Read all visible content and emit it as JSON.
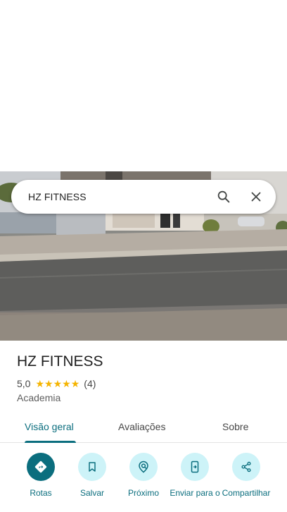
{
  "search": {
    "query": "HZ FITNESS"
  },
  "place": {
    "name": "HZ FITNESS",
    "rating": "5,0",
    "stars": 5,
    "review_count": "(4)",
    "category": "Academia"
  },
  "tabs": [
    {
      "label": "Visão geral",
      "active": true
    },
    {
      "label": "Avaliações",
      "active": false
    },
    {
      "label": "Sobre",
      "active": false
    }
  ],
  "actions": [
    {
      "label": "Rotas",
      "icon": "directions-icon"
    },
    {
      "label": "Salvar",
      "icon": "bookmark-icon"
    },
    {
      "label": "Próximo",
      "icon": "nearby-icon"
    },
    {
      "label": "Enviar para o",
      "icon": "send-to-phone-icon"
    },
    {
      "label": "Compartilhar",
      "icon": "share-icon"
    }
  ],
  "colors": {
    "accent": "#0b6e7e",
    "action_bg": "#cdf3f8",
    "star": "#f5b400"
  }
}
